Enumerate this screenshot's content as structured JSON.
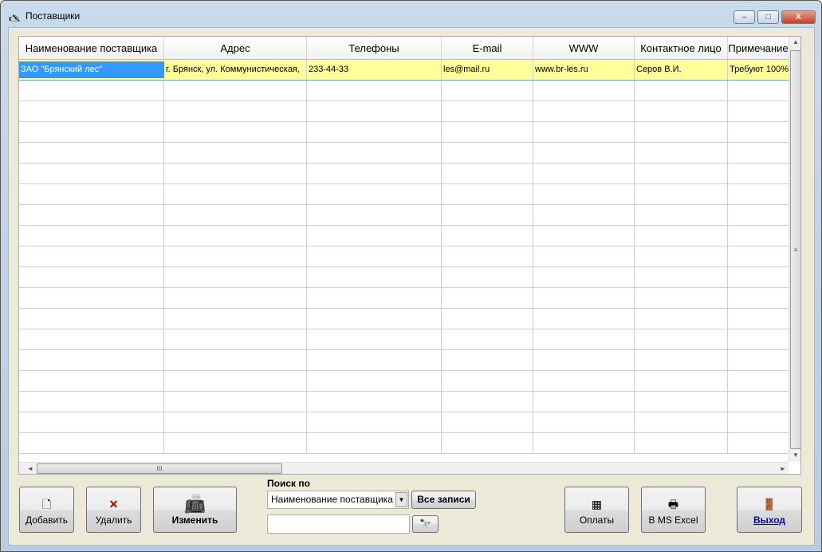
{
  "window": {
    "title": "Поставщики",
    "minimize": "–",
    "maximize": "□",
    "close": "X"
  },
  "grid": {
    "columns": [
      "Наименование поставщика",
      "Адрес",
      "Телефоны",
      "E-mail",
      "WWW",
      "Контактное лицо",
      "Примечание"
    ],
    "rows": [
      [
        "ЗАО \"Брянский лес\"",
        "г. Брянск, ул. Коммунистическая,",
        "233-44-33",
        "les@mail.ru",
        "www.br-les.ru",
        "Серов В.И.",
        "Требуют 100%"
      ]
    ],
    "empty_rows": 18
  },
  "toolbar": {
    "add": "Добавить",
    "delete": "Удалить",
    "edit": "Изменить",
    "search_label": "Поиск по",
    "search_field": "Наименование поставщика",
    "all_records": "Все записи",
    "search_value": "",
    "payments": "Оплаты",
    "excel": "В MS Excel",
    "exit": "Выход"
  }
}
